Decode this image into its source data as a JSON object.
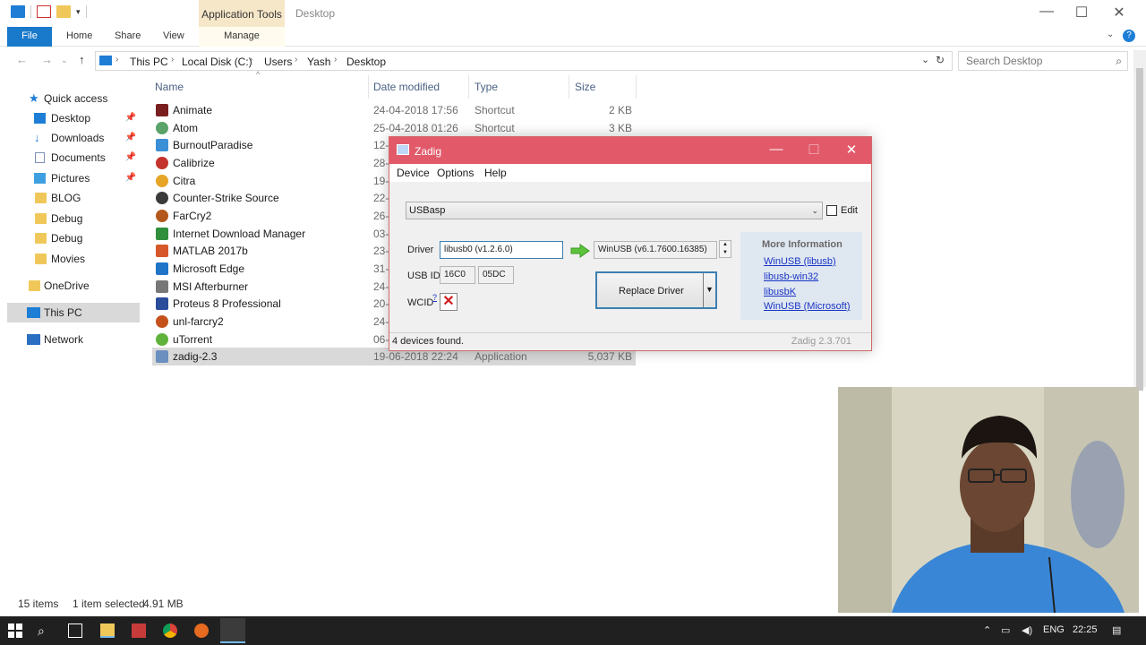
{
  "window": {
    "title": "Desktop",
    "context_tab": "Application Tools",
    "controls": {
      "minimize": "—",
      "maximize": "☐",
      "close": "✕"
    }
  },
  "ribbon": {
    "tabs": [
      "File",
      "Home",
      "Share",
      "View",
      "Manage"
    ]
  },
  "address": {
    "crumbs": [
      "This PC",
      "Local Disk (C:)",
      "Users",
      "Yash",
      "Desktop"
    ],
    "search_placeholder": "Search Desktop"
  },
  "sidebar": {
    "items": [
      {
        "label": "Quick access",
        "icon": "star-icon",
        "pinned": false
      },
      {
        "label": "Desktop",
        "icon": "desktop-icon",
        "pinned": true
      },
      {
        "label": "Downloads",
        "icon": "download-icon",
        "pinned": true
      },
      {
        "label": "Documents",
        "icon": "document-icon",
        "pinned": true
      },
      {
        "label": "Pictures",
        "icon": "picture-icon",
        "pinned": true
      },
      {
        "label": "BLOG",
        "icon": "folder-icon",
        "pinned": false
      },
      {
        "label": "Debug",
        "icon": "folder-icon",
        "pinned": false
      },
      {
        "label": "Debug",
        "icon": "folder-icon",
        "pinned": false
      },
      {
        "label": "Movies",
        "icon": "folder-icon",
        "pinned": false
      },
      {
        "label": "OneDrive",
        "icon": "folder-icon",
        "pinned": false
      },
      {
        "label": "This PC",
        "icon": "computer-icon",
        "pinned": false,
        "selected": true
      },
      {
        "label": "Network",
        "icon": "network-icon",
        "pinned": false
      }
    ]
  },
  "filelist": {
    "columns": [
      "Name",
      "Date modified",
      "Type",
      "Size"
    ],
    "rows": [
      {
        "name": "Animate",
        "date": "24-04-2018 17:56",
        "type": "Shortcut",
        "size": "2 KB",
        "color": "#7a1f1f"
      },
      {
        "name": "Atom",
        "date": "25-04-2018 01:26",
        "type": "Shortcut",
        "size": "3 KB",
        "color": "#5aa36a"
      },
      {
        "name": "BurnoutParadise",
        "date": "12-",
        "type": "",
        "size": "",
        "color": "#3b8fd6"
      },
      {
        "name": "Calibrize",
        "date": "28-",
        "type": "",
        "size": "",
        "color": "#c4332b"
      },
      {
        "name": "Citra",
        "date": "19-",
        "type": "",
        "size": "",
        "color": "#e6a526"
      },
      {
        "name": "Counter-Strike Source",
        "date": "22-",
        "type": "",
        "size": "",
        "color": "#3b3b3b"
      },
      {
        "name": "FarCry2",
        "date": "26-",
        "type": "",
        "size": "",
        "color": "#b3581c"
      },
      {
        "name": "Internet Download Manager",
        "date": "03-",
        "type": "",
        "size": "",
        "color": "#2f8f3a"
      },
      {
        "name": "MATLAB 2017b",
        "date": "23-",
        "type": "",
        "size": "",
        "color": "#d6582a"
      },
      {
        "name": "Microsoft Edge",
        "date": "31-",
        "type": "",
        "size": "",
        "color": "#1f74c7"
      },
      {
        "name": "MSI Afterburner",
        "date": "24-",
        "type": "",
        "size": "",
        "color": "#777777"
      },
      {
        "name": "Proteus 8 Professional",
        "date": "20-",
        "type": "",
        "size": "",
        "color": "#2a4c9a"
      },
      {
        "name": "unl-farcry2",
        "date": "24-",
        "type": "",
        "size": "",
        "color": "#c4511b"
      },
      {
        "name": "uTorrent",
        "date": "06-",
        "type": "",
        "size": "",
        "color": "#5fb23a"
      },
      {
        "name": "zadig-2.3",
        "date": "19-06-2018 22:24",
        "type": "Application",
        "size": "5,037 KB",
        "color": "#6b8fbf",
        "selected": true
      }
    ]
  },
  "statusbar": {
    "items": "15 items",
    "selected": "1 item selected",
    "size": "4.91 MB"
  },
  "zadig": {
    "title": "Zadig",
    "menu": [
      "Device",
      "Options",
      "Help"
    ],
    "device": "USBasp",
    "edit_label": "Edit",
    "driver_label": "Driver",
    "driver_current": "libusb0 (v1.2.6.0)",
    "driver_target": "WinUSB (v6.1.7600.16385)",
    "usbid_label": "USB ID",
    "usbid_vid": "16C0",
    "usbid_pid": "05DC",
    "wcid_label": "WCID",
    "wcid_sup": "?",
    "wcid_value": "✕",
    "button_label": "Replace Driver",
    "info_title": "More Information",
    "info_links": [
      "WinUSB (libusb)",
      "libusb-win32",
      "libusbK",
      "WinUSB (Microsoft)"
    ],
    "status": "4 devices found.",
    "version": "Zadig 2.3.701"
  },
  "taskbar": {
    "language": "ENG",
    "time": "22:25"
  }
}
